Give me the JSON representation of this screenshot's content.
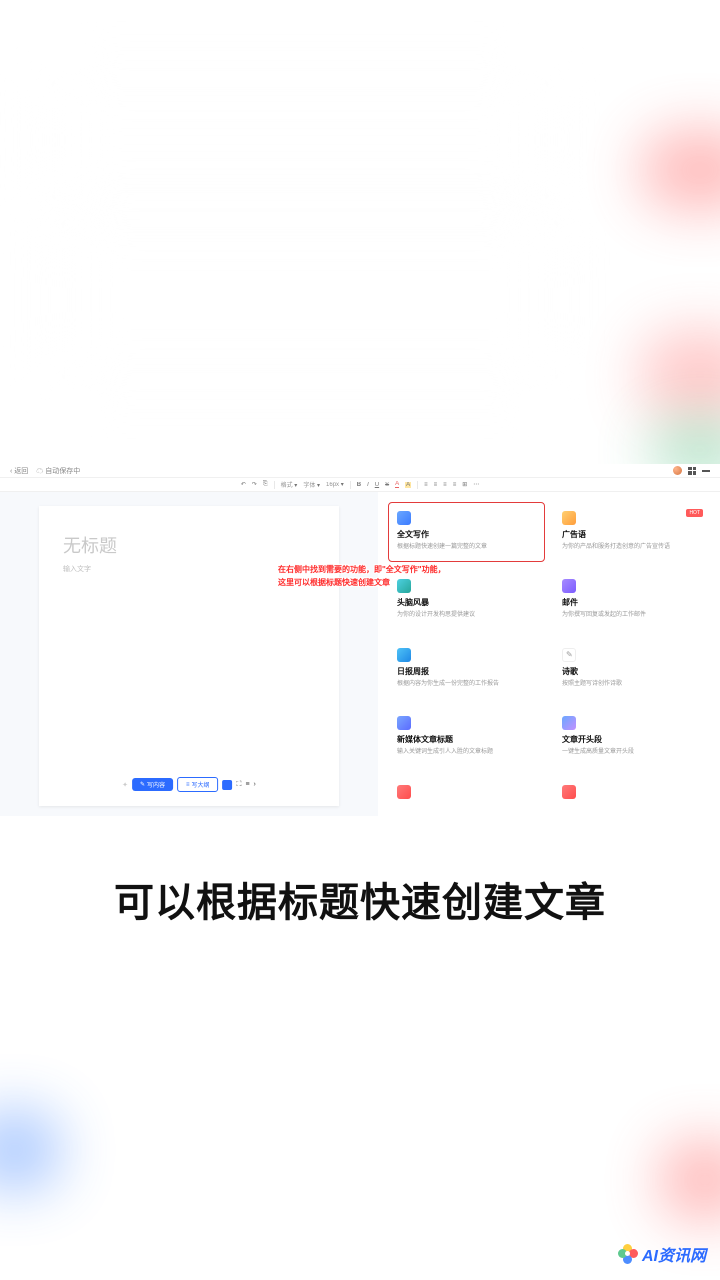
{
  "topbar": {
    "back_label": "返回",
    "autosave_label": "自动保存中"
  },
  "toolbar": {
    "items": [
      "↶",
      "↷",
      "⎘",
      "格式",
      "字体",
      "16px",
      "B",
      "I",
      "U",
      "S",
      "A",
      "A",
      "≡",
      "≡",
      "≡",
      "≡",
      "⊞",
      "⋯"
    ]
  },
  "doc": {
    "title_placeholder": "无标题",
    "body_placeholder": "输入文字"
  },
  "doc_footer": {
    "btn1": "写内容",
    "btn2": "写大纲"
  },
  "cards": [
    {
      "title": "全文写作",
      "desc": "根据标题快速创建一篇完整的文章",
      "icon": "ic-doc",
      "selected": true
    },
    {
      "title": "广告语",
      "desc": "为你的产品和服务打造创意的广告宣传语",
      "icon": "ic-ad",
      "badge": "HOT"
    },
    {
      "title": "头脑风暴",
      "desc": "为你的设计开发构思提供建议",
      "icon": "ic-brain"
    },
    {
      "title": "邮件",
      "desc": "为你撰写回复或发起的工作邮件",
      "icon": "ic-mail"
    },
    {
      "title": "日报周报",
      "desc": "根据内容为你生成一份完整的工作报告",
      "icon": "ic-report"
    },
    {
      "title": "诗歌",
      "desc": "按照主题写诗创作诗歌",
      "icon": "ic-poem"
    },
    {
      "title": "新媒体文章标题",
      "desc": "输入关键词生成引人入胜的文章标题",
      "icon": "ic-media"
    },
    {
      "title": "文章开头段",
      "desc": "一键生成高质量文章开头段",
      "icon": "ic-open"
    },
    {
      "title": "",
      "desc": "",
      "icon": "ic-red"
    },
    {
      "title": "",
      "desc": "",
      "icon": "ic-red"
    }
  ],
  "callout": {
    "line1": "在右侧中找到需要的功能，即\"全文写作\"功能，",
    "line2": "这里可以根据标题快速创建文章"
  },
  "caption": "可以根据标题快速创建文章",
  "watermark": "AI资讯网"
}
